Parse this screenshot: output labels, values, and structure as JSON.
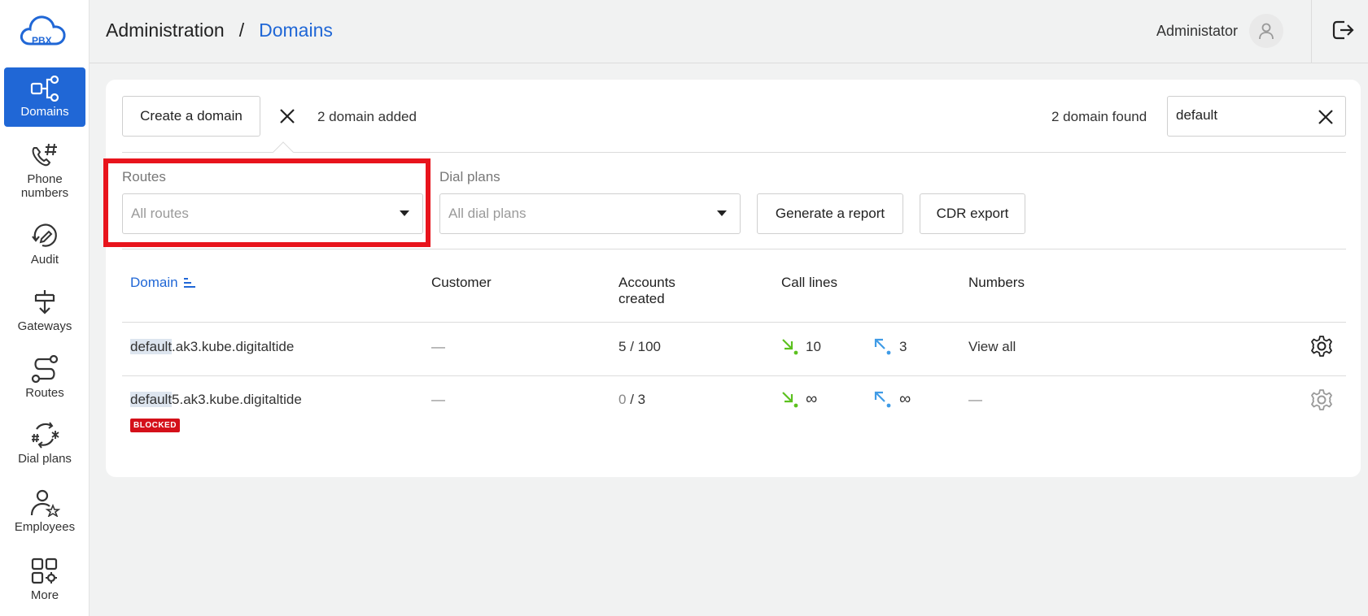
{
  "logo": {
    "text": "PBX"
  },
  "sidebar": {
    "items": [
      {
        "label": "Domains"
      },
      {
        "label": "Phone numbers"
      },
      {
        "label": "Audit"
      },
      {
        "label": "Gateways"
      },
      {
        "label": "Routes"
      },
      {
        "label": "Dial plans"
      },
      {
        "label": "Employees"
      },
      {
        "label": "More"
      }
    ]
  },
  "header": {
    "breadcrumb_root": "Administration",
    "breadcrumb_sep": "/",
    "breadcrumb_current": "Domains",
    "user_name": "Administator"
  },
  "toolbar": {
    "create_label": "Create a domain",
    "added_text": "2 domain added",
    "found_text": "2 domain found",
    "search_value": "default"
  },
  "filters": {
    "routes_label": "Routes",
    "routes_value": "All routes",
    "dialplans_label": "Dial plans",
    "dialplans_value": "All dial plans",
    "report_label": "Generate a report",
    "cdr_label": "CDR export"
  },
  "table": {
    "headers": {
      "domain": "Domain",
      "customer": "Customer",
      "accounts": "Accounts created",
      "call_lines": "Call lines",
      "numbers": "Numbers"
    },
    "rows": [
      {
        "domain_match": "default",
        "domain_rest": ".ak3.kube.digitaltide",
        "customer": "—",
        "accounts_used": "5",
        "accounts_total": " / 100",
        "incoming": "10",
        "outgoing": "3",
        "numbers": "View all"
      },
      {
        "domain_match": "default",
        "domain_rest": "5.ak3.kube.digitaltide",
        "badge": "BLOCKED",
        "customer": "—",
        "accounts_used": "0",
        "accounts_total": " / 3",
        "incoming": "∞",
        "outgoing": "∞",
        "numbers": "—"
      }
    ]
  },
  "colors": {
    "accent": "#2067d6",
    "highlight": "#e8141c",
    "incoming": "#5cc11f",
    "outgoing": "#3f9be6",
    "blocked": "#d4101a"
  }
}
